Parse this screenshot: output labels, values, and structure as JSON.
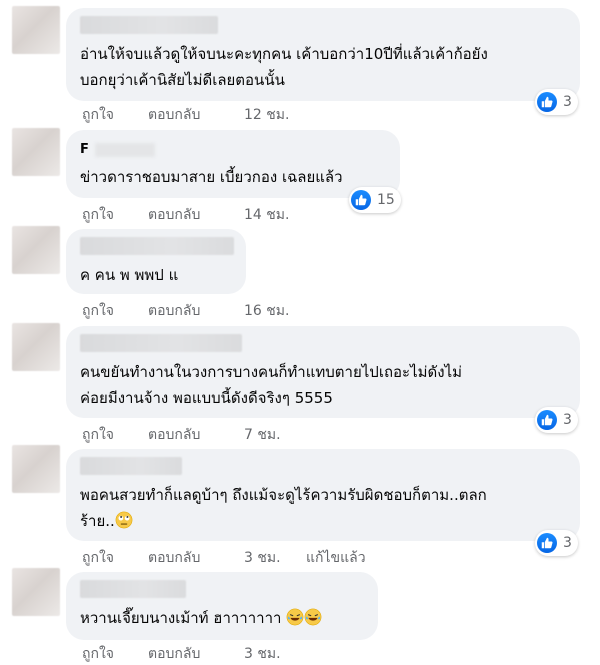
{
  "labels": {
    "like": "ถูกใจ",
    "reply": "ตอบกลับ",
    "edited": "แก้ไขแล้ว"
  },
  "colors": {
    "bubble": "#f0f2f5",
    "meta": "#65676b",
    "like_blue": "#0766e5"
  },
  "comments": [
    {
      "author": "",
      "text": "อ่านให้จบแล้วดูให้จบนะคะทุกคน เค้าบอกว่า10ปีที่แล้วเค้าก้อยัง\nบอกยุว่าเค้านิสัยไม่ดีเลยตอนนั้น",
      "time": "12 ชม.",
      "reactions": "3"
    },
    {
      "author": "F",
      "text": "ข่าวดาราชอบมาสาย เบี้ยวกอง เฉลยแล้ว",
      "time": "14 ชม.",
      "reactions": "15"
    },
    {
      "author": "",
      "text": "ค คน พ พพป แ",
      "time": "16 ชม.",
      "reactions": ""
    },
    {
      "author": "",
      "text": "คนขยันทำงานในวงการบางคนก็ทำแทบตายไปเถอะไม่ดังไม่\nค่อยมีงานจ้าง พอแบบนี้ดังดีจริงๆ 5555",
      "time": "7 ชม.",
      "reactions": "3"
    },
    {
      "author": "",
      "text": "พอคนสวยทำก็แลดูบ้าๆ ถึงแม้จะดูไร้ความรับผิดชอบก็ตาม..ตลก\nร้าย..",
      "time": "3 ชม.",
      "reactions": "3"
    },
    {
      "author": "",
      "text": "หวานเจี๊ยบนางเม้าท์ ฮาาาาาาา",
      "time": "3 ชม.",
      "reactions": ""
    }
  ]
}
